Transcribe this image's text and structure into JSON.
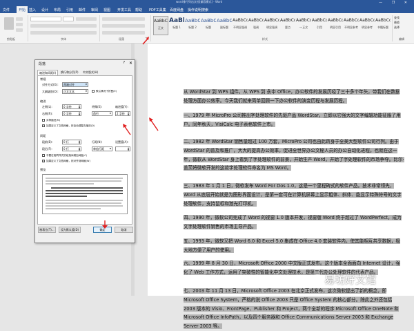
{
  "window": {
    "doc_title": "word排行列出文档[兼容模式] - Word",
    "controls": "— ❐ ✕"
  },
  "ribbon_tabs": [
    "文件",
    "开始",
    "插入",
    "设计",
    "布局",
    "引用",
    "邮件",
    "审阅",
    "视图",
    "开发工具",
    "帮助",
    "PDF工具集",
    "百度网盘",
    "操作说明搜索"
  ],
  "ribbon": {
    "groups": [
      "剪贴板",
      "字体",
      "段落",
      "样式",
      "编辑"
    ],
    "styles": [
      {
        "sample": "AaBbCcDd",
        "label": "正文",
        "kind": "normal"
      },
      {
        "sample": "AaBb",
        "label": "标题 1",
        "kind": "big"
      },
      {
        "sample": "AaBbC",
        "label": "标题 2",
        "kind": "heading"
      },
      {
        "sample": "AaBbC",
        "label": "标题",
        "kind": "heading"
      },
      {
        "sample": "AaBbC",
        "label": "副标题",
        "kind": "heading"
      },
      {
        "sample": "AaBbCcDd",
        "label": "不明显强调",
        "kind": "normal"
      },
      {
        "sample": "AaBbCcDd",
        "label": "强调",
        "kind": "normal"
      },
      {
        "sample": "AaBbCcDd",
        "label": "明显强调",
        "kind": "normal"
      },
      {
        "sample": "AaBbCcDd",
        "label": "要点",
        "kind": "normal"
      },
      {
        "sample": "AaBbCcDd",
        "label": "→ 正文",
        "kind": "normal"
      },
      {
        "sample": "AaBbCcDd",
        "label": "引用",
        "kind": "normal"
      },
      {
        "sample": "AaBbCcDd",
        "label": "明显引用",
        "kind": "normal"
      },
      {
        "sample": "AaBbCcDd",
        "label": "不明显参考",
        "kind": "normal"
      },
      {
        "sample": "AaBbCcDd",
        "label": "明显参考",
        "kind": "normal"
      },
      {
        "sample": "AaBbCcDd",
        "label": "书籍标题",
        "kind": "normal"
      }
    ],
    "editing": [
      "查找",
      "替换",
      "选择"
    ]
  },
  "dialog": {
    "title": "段落",
    "help": "?",
    "close": "✕",
    "tabs": [
      "缩进和间距(I)",
      "换行和分页(P)",
      "中文版式(H)"
    ],
    "general": {
      "section": "常规",
      "alignment_label": "对齐方式(G):",
      "alignment_value": "两端对齐",
      "outline_label": "大纲级别(O):",
      "outline_value": "正文文本",
      "collapsed_label": "默认情况下折叠(E)"
    },
    "indent": {
      "section": "缩进",
      "left_label": "左侧(L):",
      "left_value": "0 字符",
      "right_label": "右侧(R):",
      "right_value": "0 字符",
      "special_label": "特殊(S):",
      "special_value": "首行",
      "by_label": "缩进值(Y):",
      "by_value": "2 字符",
      "mirror_label": "对称缩进(M)",
      "auto_adjust_label": "如果定义了文档网格，则自动调整右缩进(D)"
    },
    "spacing": {
      "section": "间距",
      "before_label": "段前(B):",
      "before_value": "0 行",
      "after_label": "段后(F):",
      "after_value": "0 行",
      "line_label": "行距(N):",
      "line_value": "单倍行距",
      "at_label": "设置值(A):",
      "no_space_label": "不要在相同样式的段落间增加间距(C)",
      "snap_label": "如果定义了文档网格，则对齐到网格(W)"
    },
    "preview_section": "预览",
    "buttons": {
      "tabs": "制表位(T)...",
      "default": "设为默认值(D)",
      "ok": "确定",
      "cancel": "取消"
    }
  },
  "document": {
    "paragraphs": [
      "从 WordStar 到 WPS 组件，从 WPS 到 永中 Office，办公软件的发展历经了三十多个年头，带我们在数据处理方面办公效率。今天我们就来简单回顾一下办公软件的演变历程与发展历程。",
      "一、1979 年 MicroPro 公司推出字处理软件的先驱产品 WordStar，立即以它强大的文字编辑功能征服了用户。同年秋天，VisiCalc 电子表格软件上市。",
      "二、1982 年 WordStar 销售量超过 100 万套，MicroPro 公司也由此跻身于全美大型软件公司行列。由于 WordStar 的普及和推广，大大的提高办公效率，促进全世界办公文秘人员的办公自动化进程。也就在这一年，微软从 WordStar 身上看到了字处理软件的前景，开始生产 Word，开始了字处理软件的市场争夺。比尔·盖茨将微软开发的这款字处理软件命名为 MS Word。",
      "三、1983 年 1 月 1 日，微软发布 Word For Dos 1.0，这是一个里程碑式的软件产品。技术非常领先，Word 从底层开始就是为图形界面设计，是第一套可在计算机屏幕上显示粗体、斜体、能显示特殊符号的文字处理软件，支持鼠标和激光打印机。",
      "四、1990 年，微软公司完成了 Word 的视窗 1.0 版本开发，视窗版 Word 终于超过了 WordPerfect，成为文字处理软件销售的市场主导产品。",
      "五、1993 年，微软又把 Word 6.0 和 Excel 5.0 集成在 Office 4.0 套装软件内，使其能相互共享数据，极大地方便了用户的使用。",
      "六、1999 年 8 月 30 日，Microsoft Office 2000 中文版正式发布。这个版本全面面向 Internet 设计，强化了 Web 工作方式，运用了突破性的智能化中文处理技术，是第三代办公处理软件的代表产品。",
      "七、2003 年 11 月 13 日，Microsoft Office 2003 在北京正式发布，这次微软提出了新的概念，即 Microsoft Office System，严格的说 Office 2003 只是 Office System 的核心部分。除此之外还包括 2003 版本的 Visio、FrontPage、Publisher 和 Project，两个全新的程序 Microsoft Office OneNote 和 Microsoft Office InfoPath，以及四个服务器和 Office Communications Server 2003 和 Exchange Server 2003 等。"
    ]
  },
  "watermark": "易坊好文馆"
}
